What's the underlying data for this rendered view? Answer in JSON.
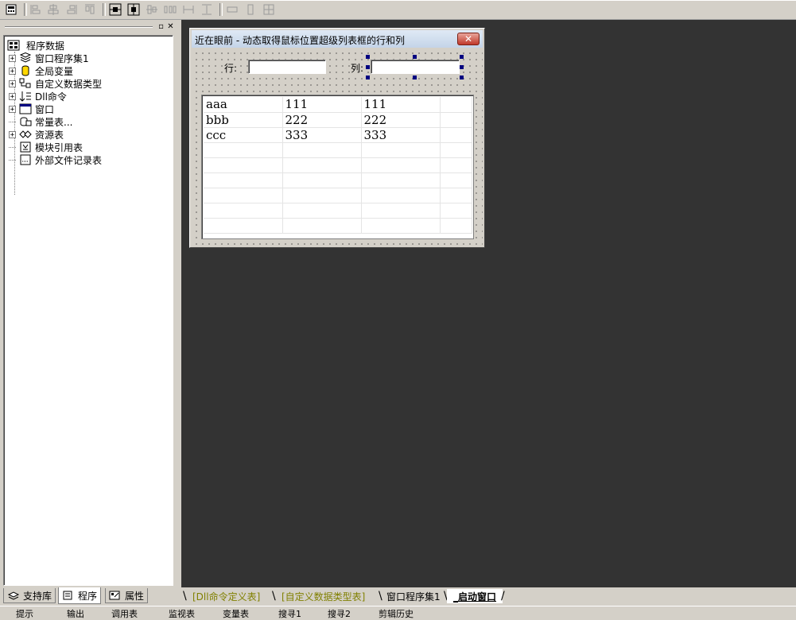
{
  "toolbar": {
    "buttons": [
      "calculator-icon",
      "align-left-icon",
      "align-center-v-icon",
      "align-right-icon",
      "align-top-icon",
      "align-middle-icon",
      "align-bottom-icon",
      "center-h-icon",
      "center-v-icon",
      "space-across-icon",
      "space-down-icon",
      "same-width-icon",
      "same-height-icon",
      "same-size-icon"
    ]
  },
  "tree": {
    "root": "程序数据",
    "items": [
      {
        "label": "窗口程序集1",
        "icon": "stack-icon",
        "expandable": true
      },
      {
        "label": "全局变量",
        "icon": "cylinder-icon",
        "expandable": true
      },
      {
        "label": "自定义数据类型",
        "icon": "struct-icon",
        "expandable": true
      },
      {
        "label": "Dll命令",
        "icon": "dll-icon",
        "expandable": true
      },
      {
        "label": "窗口",
        "icon": "window-icon",
        "expandable": true
      },
      {
        "label": "常量表...",
        "icon": "constant-icon",
        "expandable": false
      },
      {
        "label": "资源表",
        "icon": "resource-icon",
        "expandable": true
      },
      {
        "label": "模块引用表",
        "icon": "module-icon",
        "expandable": false
      },
      {
        "label": "外部文件记录表",
        "icon": "file-record-icon",
        "expandable": false
      }
    ]
  },
  "left_tabs": [
    "支持库",
    "程序",
    "属性"
  ],
  "form": {
    "title": "近在眼前 - 动态取得鼠标位置超级列表框的行和列",
    "close": "✕",
    "row_label": "行:",
    "col_label": "列:",
    "row_value": "",
    "col_value": ""
  },
  "grid_rows": [
    [
      "aaa",
      "111",
      "111"
    ],
    [
      "bbb",
      "222",
      "222"
    ],
    [
      "ccc",
      "333",
      "333"
    ]
  ],
  "doc_tabs": [
    "[Dll命令定义表]",
    "[自定义数据类型表]",
    "窗口程序集1",
    "_启动窗口"
  ],
  "status": [
    "提示",
    "输出",
    "调用表",
    "监视表",
    "变量表",
    "搜寻1",
    "搜寻2",
    "剪辑历史"
  ]
}
